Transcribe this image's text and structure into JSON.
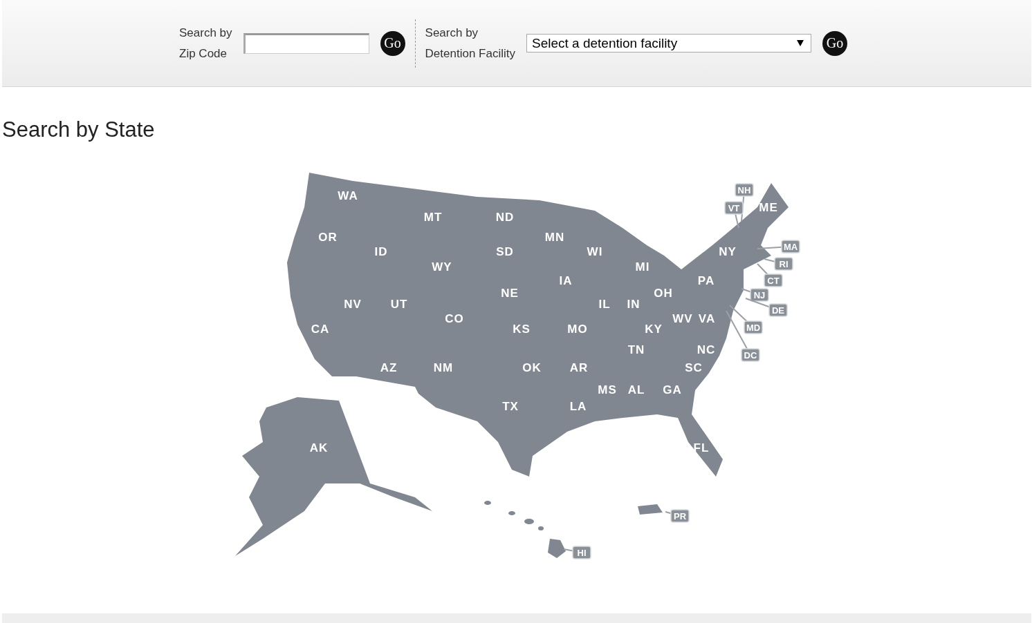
{
  "search_bar": {
    "zip": {
      "label_line1": "Search by",
      "label_line2": "Zip Code",
      "button": "Go"
    },
    "facility": {
      "label_line1": "Search by",
      "label_line2": "Detention Facility",
      "select_value": "Select a detention facility",
      "button": "Go"
    }
  },
  "heading": "Search by State",
  "states": [
    {
      "code": "WA",
      "kind": "plain"
    },
    {
      "code": "ME",
      "kind": "plain"
    },
    {
      "code": "MT",
      "kind": "plain"
    },
    {
      "code": "ND",
      "kind": "plain"
    },
    {
      "code": "OR",
      "kind": "plain"
    },
    {
      "code": "MN",
      "kind": "plain"
    },
    {
      "code": "ID",
      "kind": "plain"
    },
    {
      "code": "SD",
      "kind": "plain"
    },
    {
      "code": "WI",
      "kind": "plain"
    },
    {
      "code": "NY",
      "kind": "plain"
    },
    {
      "code": "WY",
      "kind": "plain"
    },
    {
      "code": "MI",
      "kind": "plain"
    },
    {
      "code": "IA",
      "kind": "plain"
    },
    {
      "code": "PA",
      "kind": "plain"
    },
    {
      "code": "NE",
      "kind": "plain"
    },
    {
      "code": "OH",
      "kind": "plain"
    },
    {
      "code": "NV",
      "kind": "plain"
    },
    {
      "code": "UT",
      "kind": "plain"
    },
    {
      "code": "IL",
      "kind": "plain"
    },
    {
      "code": "IN",
      "kind": "plain"
    },
    {
      "code": "CO",
      "kind": "plain"
    },
    {
      "code": "WV",
      "kind": "plain"
    },
    {
      "code": "VA",
      "kind": "plain"
    },
    {
      "code": "CA",
      "kind": "plain"
    },
    {
      "code": "KS",
      "kind": "plain"
    },
    {
      "code": "MO",
      "kind": "plain"
    },
    {
      "code": "KY",
      "kind": "plain"
    },
    {
      "code": "TN",
      "kind": "plain"
    },
    {
      "code": "NC",
      "kind": "plain"
    },
    {
      "code": "AZ",
      "kind": "plain"
    },
    {
      "code": "NM",
      "kind": "plain"
    },
    {
      "code": "OK",
      "kind": "plain"
    },
    {
      "code": "AR",
      "kind": "plain"
    },
    {
      "code": "SC",
      "kind": "plain"
    },
    {
      "code": "MS",
      "kind": "plain"
    },
    {
      "code": "AL",
      "kind": "plain"
    },
    {
      "code": "GA",
      "kind": "plain"
    },
    {
      "code": "TX",
      "kind": "plain"
    },
    {
      "code": "LA",
      "kind": "plain"
    },
    {
      "code": "AK",
      "kind": "plain"
    },
    {
      "code": "FL",
      "kind": "plain"
    },
    {
      "code": "NH",
      "kind": "tag"
    },
    {
      "code": "VT",
      "kind": "tag"
    },
    {
      "code": "MA",
      "kind": "tag"
    },
    {
      "code": "RI",
      "kind": "tag"
    },
    {
      "code": "CT",
      "kind": "tag"
    },
    {
      "code": "NJ",
      "kind": "tag"
    },
    {
      "code": "DE",
      "kind": "tag"
    },
    {
      "code": "MD",
      "kind": "tag"
    },
    {
      "code": "DC",
      "kind": "tag"
    },
    {
      "code": "PR",
      "kind": "tag"
    },
    {
      "code": "HI",
      "kind": "tag"
    }
  ]
}
